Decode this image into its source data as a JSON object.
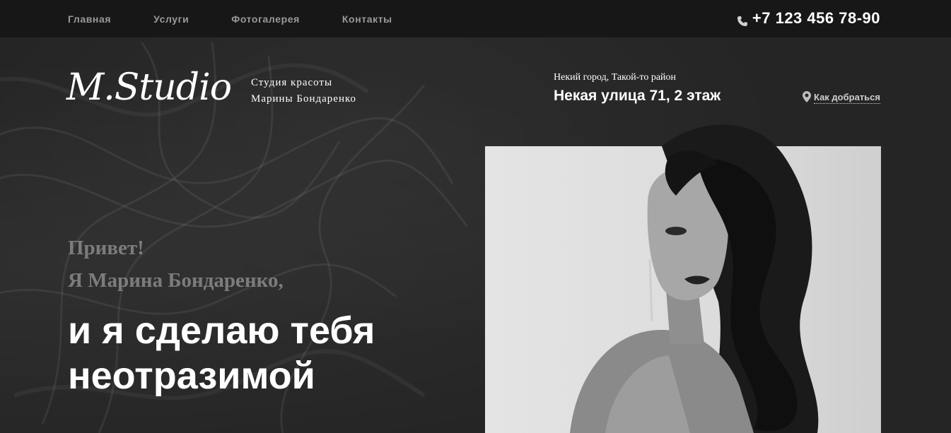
{
  "nav": {
    "items": [
      {
        "label": "Главная"
      },
      {
        "label": "Услуги"
      },
      {
        "label": "Фотогалерея"
      },
      {
        "label": "Контакты"
      }
    ]
  },
  "header": {
    "phone": "+7 123 456 78-90",
    "phone_icon": "phone-icon"
  },
  "brand": {
    "logo_text": "M.Studio",
    "tagline_line1": "Студия красоты",
    "tagline_line2": "Марины Бондаренко"
  },
  "address": {
    "city": "Некий город, Такой-то район",
    "street": "Некая улица 71, 2 этаж",
    "directions_label": "Как добраться",
    "directions_icon": "map-pin-icon"
  },
  "hero": {
    "greet_line1": "Привет!",
    "greet_line2": "Я Марина Бондаренко,",
    "headline_line1": "и я сделаю тебя",
    "headline_line2": "неотразимой"
  },
  "colors": {
    "topbar_bg": "#171717",
    "page_bg": "#262626",
    "nav_text": "#9a9a9a",
    "greet_text": "#7c7c7c"
  }
}
